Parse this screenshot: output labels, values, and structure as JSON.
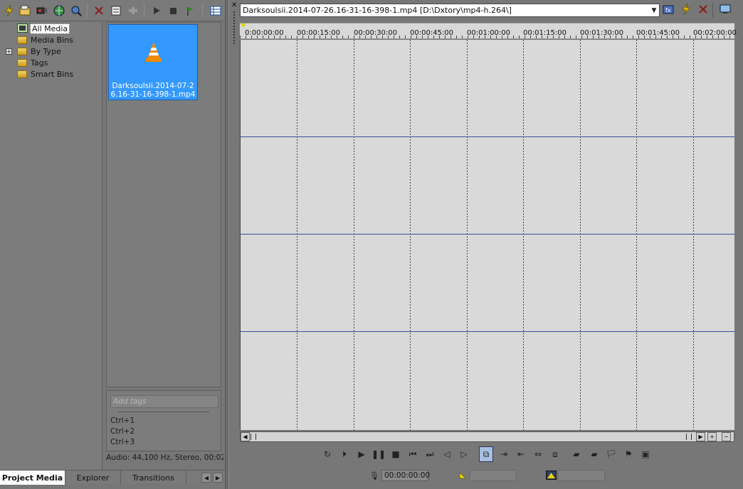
{
  "left_toolbar": {
    "icons": [
      "lightning-icon",
      "import-media-icon",
      "capture-icon",
      "get-media-web-icon",
      "search-media-icon",
      "delete-icon",
      "media-properties-icon",
      "plug-in-chooser-icon",
      "play-icon",
      "stop-icon",
      "auto-preview-icon",
      "views-icon"
    ]
  },
  "tree": {
    "items": [
      {
        "label": "All Media",
        "selected": true
      },
      {
        "label": "Media Bins"
      },
      {
        "label": "By Type",
        "expander": "+"
      },
      {
        "label": "Tags"
      },
      {
        "label": "Smart Bins"
      }
    ]
  },
  "media": {
    "item_caption": "Darksoulsii.2014-07-26.16-31-16-398-1.mp4"
  },
  "tags": {
    "placeholder": "Add tags",
    "shortcuts": [
      "Ctrl+1",
      "Ctrl+2",
      "Ctrl+3"
    ]
  },
  "status": {
    "text": "Audio: 44,100 Hz, Stereo, 00:02:"
  },
  "tabs": [
    "Project Media",
    "Explorer",
    "Transitions"
  ],
  "trimmer": {
    "file_label": "Darksoulsii.2014-07-26.16-31-16-398-1.mp4    [D:\\Dxtory\\mp4-h.264\\]",
    "ruler_labels": [
      "0:00:00:00",
      "00:00:15:00",
      "00:00:30:00",
      "00:00:45:00",
      "00:01:00:00",
      "00:01:15:00",
      "00:01:30:00",
      "00:01:45:00",
      "00:02:00:00"
    ],
    "timecode": "00:00:00:00"
  },
  "colors": {
    "selected_thumb": "#3399ff",
    "track_bg": "#d9d9d9",
    "track_line": "#3a4f9a"
  }
}
